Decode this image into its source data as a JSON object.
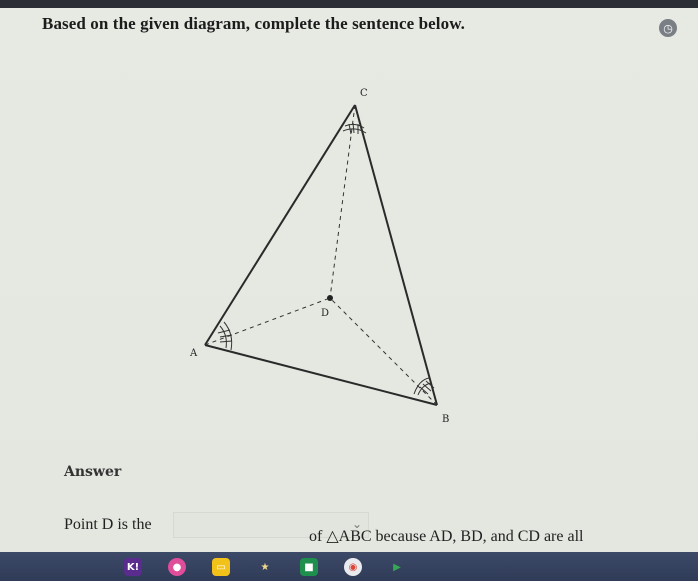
{
  "prompt": "Based on the given diagram, complete the sentence below.",
  "diagram": {
    "labels": {
      "a": "A",
      "b": "B",
      "c": "C",
      "d": "D"
    }
  },
  "answer": {
    "label": "Answer",
    "sentence_start": "Point D is the",
    "dropdown_value": "",
    "sentence_end": "of △ABC because AD, BD, and CD are all"
  },
  "taskbar": {
    "icons": [
      "kahoot-icon",
      "quiz-icon",
      "slides-icon",
      "star-icon",
      "video-icon",
      "chrome-icon",
      "play-icon"
    ],
    "kahoot_text": "K!"
  }
}
